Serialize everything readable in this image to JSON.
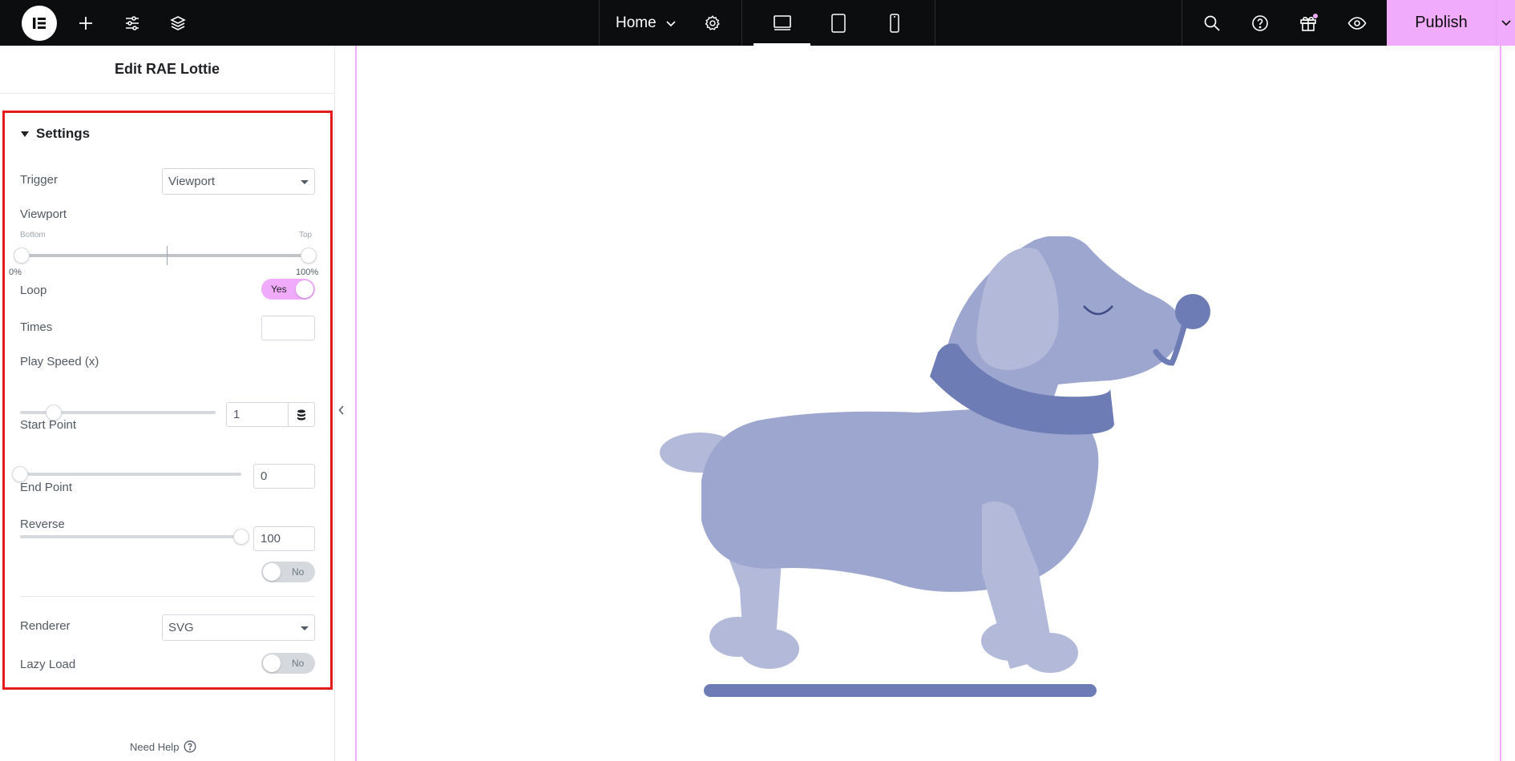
{
  "topbar": {
    "icons": [
      "elementor-logo-icon",
      "add-element-icon",
      "site-settings-icon",
      "structure-layers-icon",
      "page-settings-gear-icon",
      "desktop-icon",
      "tablet-icon",
      "mobile-icon",
      "search-icon",
      "help-icon",
      "whats-new-gift-icon",
      "preview-eye-icon"
    ],
    "page_name": "Home",
    "publish_label": "Publish",
    "accent_color": "#f0abfc"
  },
  "panel": {
    "title": "Edit RAE Lottie",
    "section_title": "Settings",
    "trigger": {
      "label": "Trigger",
      "value": "Viewport"
    },
    "viewport": {
      "label": "Viewport",
      "min_caption": "Bottom",
      "max_caption": "Top",
      "min_value": "0%",
      "max_value": "100%",
      "range_start": 0,
      "range_end": 100
    },
    "loop": {
      "label": "Loop",
      "state": "Yes"
    },
    "times": {
      "label": "Times",
      "value": ""
    },
    "play_speed": {
      "label": "Play Speed (x)",
      "value": "1",
      "slider_fraction": 0.18
    },
    "start_point": {
      "label": "Start Point",
      "value": "0",
      "slider_fraction": 0.0
    },
    "end_point": {
      "label": "End Point",
      "value": "100",
      "slider_fraction": 1.0
    },
    "reverse": {
      "label": "Reverse",
      "state": "No"
    },
    "renderer": {
      "label": "Renderer",
      "value": "SVG"
    },
    "lazy_load": {
      "label": "Lazy Load",
      "state": "No"
    },
    "need_help": "Need Help"
  },
  "canvas": {
    "illustration": "dog-lottie-animation",
    "illustration_color": "#9ca6cf"
  }
}
